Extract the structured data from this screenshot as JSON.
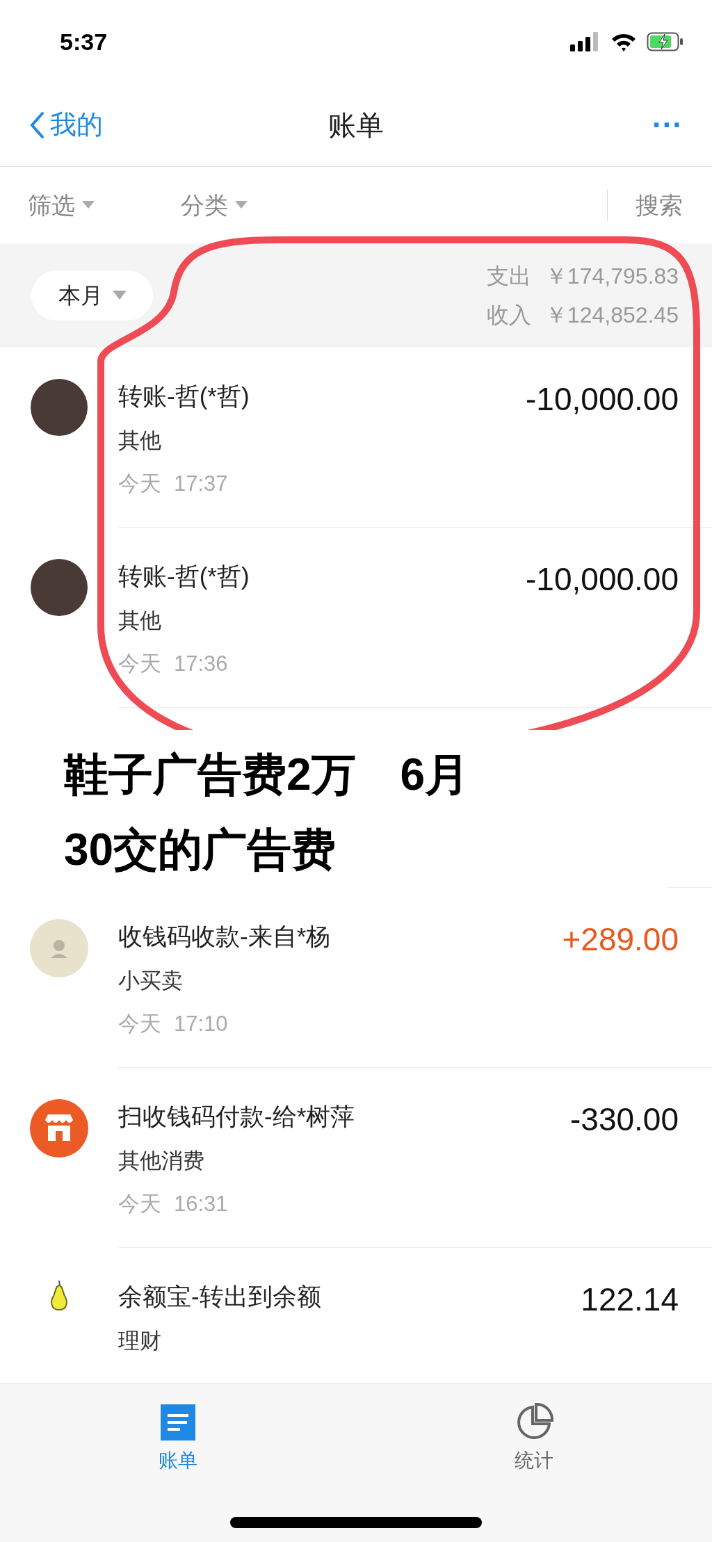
{
  "status_bar": {
    "time": "5:37"
  },
  "nav": {
    "back_label": "我的",
    "title": "账单",
    "more": "···"
  },
  "filters": [
    {
      "label": "筛选"
    },
    {
      "label": "分类"
    }
  ],
  "search": {
    "label": "搜索"
  },
  "summary": {
    "period": "本月",
    "lines": [
      {
        "label": "支出",
        "value": "￥174,795.83"
      },
      {
        "label": "收入",
        "value": "￥124,852.45"
      }
    ]
  },
  "transactions": [
    {
      "kind": "photo",
      "title": "转账-哲(*哲)",
      "category": "其他",
      "date": "今天",
      "time": "17:37",
      "amount": "-10,000.00",
      "color": "#111111"
    },
    {
      "kind": "photo",
      "title": "转账-哲(*哲)",
      "category": "其他",
      "date": "今天",
      "time": "17:36",
      "amount": "-10,000.00",
      "color": "#111111"
    },
    {
      "kind": "hidden"
    },
    {
      "kind": "person",
      "title": "收钱码收款-来自*杨",
      "category": "小买卖",
      "date": "今天",
      "time": "17:10",
      "amount": "+289.00",
      "color": "#e8581f"
    },
    {
      "kind": "store",
      "title": "扫收钱码付款-给*树萍",
      "category": "其他消费",
      "date": "今天",
      "time": "16:31",
      "amount": "-330.00",
      "color": "#111111"
    },
    {
      "kind": "pear",
      "title": "余额宝-转出到余额",
      "category": "理财",
      "amount": "122.14",
      "color": "#111111"
    }
  ],
  "annotation": {
    "lines": [
      "鞋子广告费2万　6月",
      "30交的广告费"
    ]
  },
  "tab_bar": [
    {
      "label": "账单",
      "selected": true
    },
    {
      "label": "统计",
      "selected": false
    }
  ]
}
